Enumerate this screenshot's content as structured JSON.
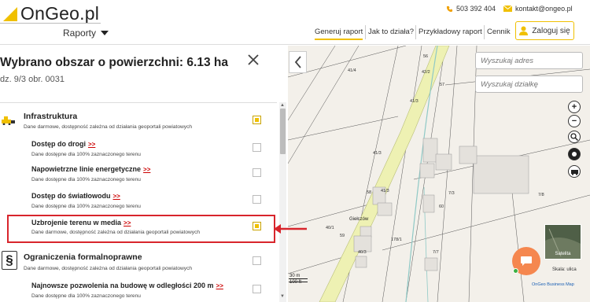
{
  "header": {
    "logo_text": "OnGeo.pl",
    "reports_label": "Raporty",
    "phone": "503 392 404",
    "email": "kontakt@ongeo.pl",
    "nav": [
      "Generuj raport",
      "Jak to działa?",
      "Przykładowy raport",
      "Cennik"
    ],
    "login_label": "Zaloguj się",
    "accent": "#f0c000"
  },
  "panel": {
    "title": "Wybrano obszar o powierzchni: 6.13 ha",
    "subtitle": "dz. 9/3 obr. 0031",
    "more_link": ">>",
    "categories": [
      {
        "name": "Infrastruktura",
        "desc": "Dane darmowe, dostępność zależna od działania geoportali powiatowych",
        "checked": true,
        "items": [
          {
            "name": "Dostęp do drogi",
            "desc": "Dane dostępne dla 100% zaznaczonego terenu",
            "checked": false
          },
          {
            "name": "Napowietrzne linie energetyczne",
            "desc": "Dane dostępne dla 100% zaznaczonego terenu",
            "checked": false
          },
          {
            "name": "Dostęp do światłowodu",
            "desc": "Dane dostępne dla 100% zaznaczonego terenu",
            "checked": false
          },
          {
            "name": "Uzbrojenie terenu w media",
            "desc": "Dane darmowe, dostępność zależna od działania geoportali powiatowych",
            "checked": true
          }
        ]
      },
      {
        "name": "Ograniczenia formalnoprawne",
        "desc": "Dane darmowe, dostępność zależna od działania geoportali powiatowych",
        "checked": false,
        "items": [
          {
            "name": "Najnowsze pozwolenia na budowę w odległości 200 m",
            "desc": "Dane dostępne dla 100% zaznaczonego terenu",
            "checked": false
          }
        ]
      }
    ]
  },
  "map": {
    "search_address_placeholder": "Wyszukaj adres",
    "search_parcel_placeholder": "Wyszukaj działkę",
    "tools": [
      "zoom-in-icon",
      "zoom-out-icon",
      "search-zoom-icon",
      "location-icon",
      "street-view-icon"
    ],
    "satellite_label": "Satelita",
    "scale_label": "Skala: ulica",
    "credit": "OnGeo Business Map",
    "scale_m": "30 m",
    "scale_ft": "100 ft",
    "place_name": "Giełczów",
    "parcel_labels": [
      "56",
      "42/2",
      "57",
      "41/4",
      "41/3",
      "41/3",
      "58",
      "41/3",
      "7/3",
      "7/8",
      "60",
      "40/1",
      "59",
      "178/1",
      "7/7",
      "40/3"
    ]
  }
}
